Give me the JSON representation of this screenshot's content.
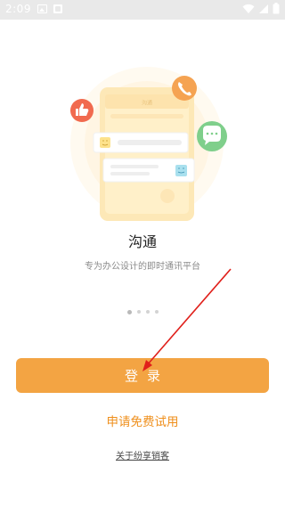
{
  "status_bar": {
    "time": "2:09",
    "icons": [
      "gallery-icon",
      "notification-box-icon",
      "wifi-icon",
      "signal-icon",
      "battery-icon"
    ]
  },
  "hero": {
    "phone_header": "沟通",
    "icons": [
      "thumbs-up-icon",
      "phone-icon",
      "chat-bubble-icon",
      "smiley-icon"
    ]
  },
  "intro": {
    "title": "沟通",
    "subtitle": "专为办公设计的即时通讯平台"
  },
  "pager": {
    "count": 4,
    "active_index": 0
  },
  "actions": {
    "login_label": "登录",
    "trial_label": "申请免费试用",
    "about_label": "关于纷享销客"
  },
  "colors": {
    "accent": "#f3a443",
    "link": "#ef8f1c",
    "annotation_arrow": "#e0201b"
  }
}
